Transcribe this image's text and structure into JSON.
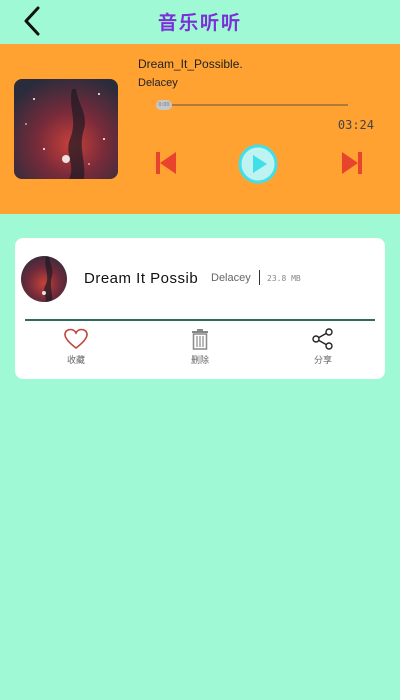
{
  "header": {
    "title": "音乐听听",
    "back_icon": "chevron-left-icon"
  },
  "player": {
    "song_title": "Dream_It_Possible.",
    "artist": "Delacey",
    "current_time": "0:00",
    "total_time": "03:24",
    "progress": 0,
    "accent_color": "#ffa232",
    "controls": {
      "prev_icon": "skip-previous-icon",
      "play_icon": "play-icon",
      "next_icon": "skip-next-icon"
    }
  },
  "song_card": {
    "title": "Dream It Possib",
    "artist": "Delacey",
    "size": "23.8 MB",
    "actions": [
      {
        "label": "收藏",
        "icon": "heart-icon"
      },
      {
        "label": "删除",
        "icon": "trash-icon"
      },
      {
        "label": "分享",
        "icon": "share-icon"
      }
    ]
  },
  "colors": {
    "background": "#9ef9d4",
    "title": "#7b2fd8",
    "control_red": "#e8442d",
    "play_cyan": "#3fe0ea"
  }
}
